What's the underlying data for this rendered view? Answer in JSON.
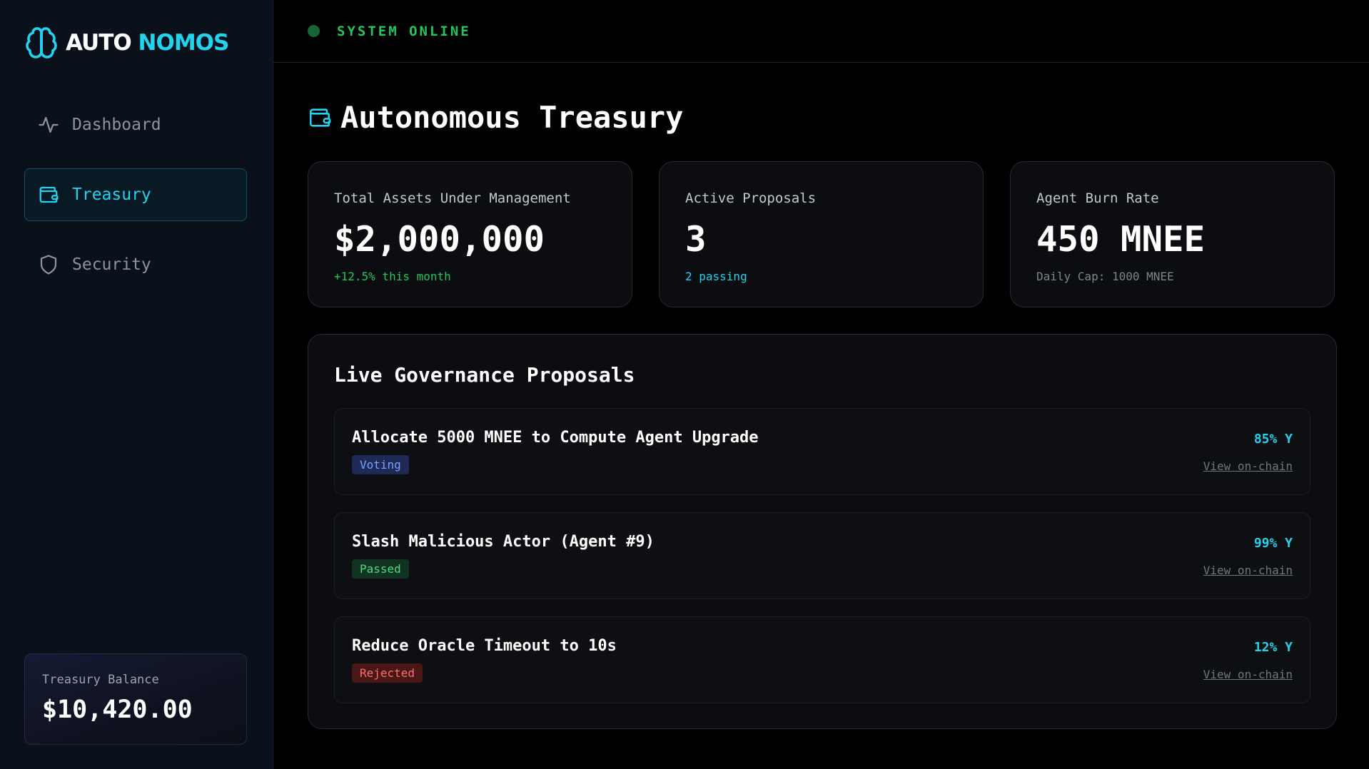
{
  "brand": {
    "part1": "AUTO",
    "part2": "NOMOS",
    "logo_icon": "brain-icon"
  },
  "sidebar": {
    "items": [
      {
        "label": "Dashboard",
        "icon": "activity-icon",
        "active": false
      },
      {
        "label": "Treasury",
        "icon": "wallet-icon",
        "active": true
      },
      {
        "label": "Security",
        "icon": "shield-icon",
        "active": false
      }
    ],
    "balance": {
      "label": "Treasury Balance",
      "value": "$10,420.00"
    }
  },
  "status": {
    "text": "SYSTEM ONLINE",
    "color": "#22c55e"
  },
  "page": {
    "title": "Autonomous Treasury",
    "icon": "wallet-icon"
  },
  "stats": [
    {
      "label": "Total Assets Under Management",
      "value": "$2,000,000",
      "sub": "+12.5% this month",
      "sub_color": "#22c55e"
    },
    {
      "label": "Active Proposals",
      "value": "3",
      "sub": "2 passing",
      "sub_color": "#22d3ee"
    },
    {
      "label": "Agent Burn Rate",
      "value": "450 MNEE",
      "sub": "Daily Cap: 1000 MNEE",
      "sub_color": "#7d8590"
    }
  ],
  "governance": {
    "title": "Live Governance Proposals",
    "link_label": "View on-chain",
    "proposals": [
      {
        "title": "Allocate 5000 MNEE to Compute Agent Upgrade",
        "status": "Voting",
        "yes": "85% Y"
      },
      {
        "title": "Slash Malicious Actor (Agent #9)",
        "status": "Passed",
        "yes": "99% Y"
      },
      {
        "title": "Reduce Oracle Timeout to 10s",
        "status": "Rejected",
        "yes": "12% Y"
      }
    ]
  },
  "colors": {
    "accent": "#22d3ee",
    "success": "#22c55e",
    "danger": "#f87171",
    "background": "#000000",
    "sidebar": "#0b111a"
  }
}
